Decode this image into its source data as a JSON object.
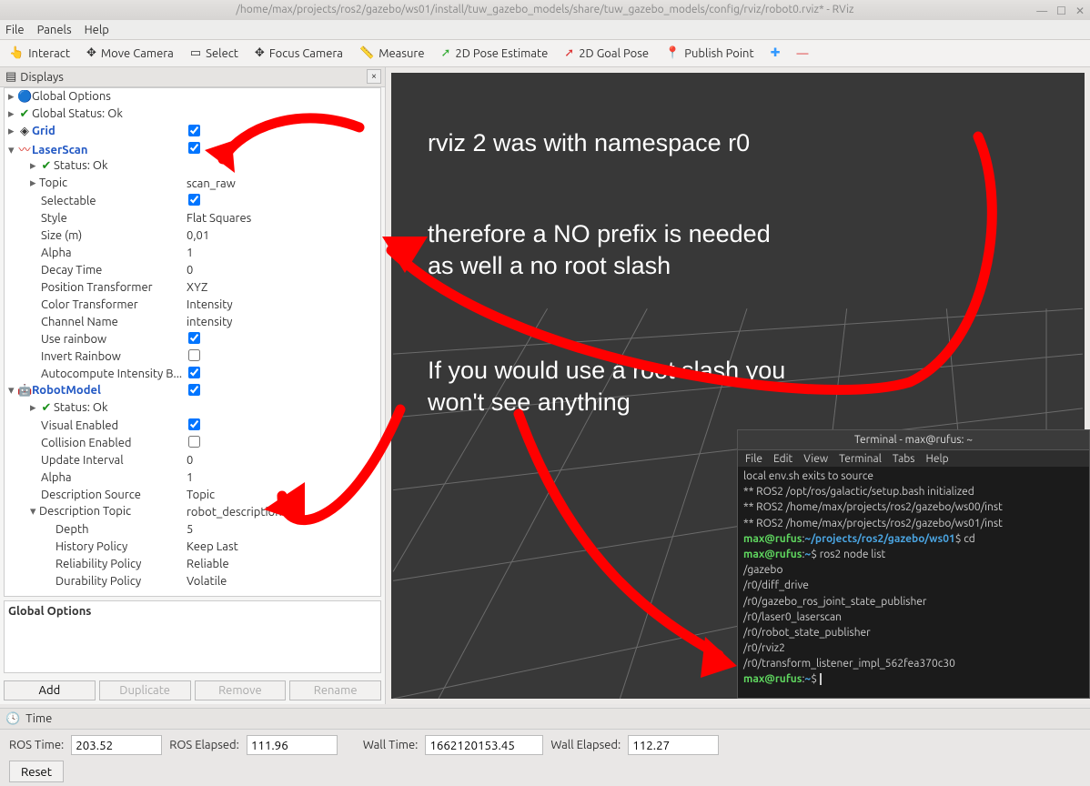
{
  "window": {
    "title": "/home/max/projects/ros2/gazebo/ws01/install/tuw_gazebo_models/share/tuw_gazebo_models/config/rviz/robot0.rviz* - RViz"
  },
  "menubar": [
    "File",
    "Panels",
    "Help"
  ],
  "toolbar": {
    "interact": "Interact",
    "move": "Move Camera",
    "select": "Select",
    "focus": "Focus Camera",
    "measure": "Measure",
    "est": "2D Pose Estimate",
    "goal": "2D Goal Pose",
    "pub": "Publish Point"
  },
  "displays_title": "Displays",
  "tree": {
    "global_options": "Global Options",
    "global_status": "Global Status: Ok",
    "grid": "Grid",
    "laserscan": "LaserScan",
    "ls_status": "Status: Ok",
    "ls_topic_k": "Topic",
    "ls_topic_v": "scan_raw",
    "ls_selectable": "Selectable",
    "ls_style_k": "Style",
    "ls_style_v": "Flat Squares",
    "ls_size_k": "Size (m)",
    "ls_size_v": "0,01",
    "ls_alpha_k": "Alpha",
    "ls_alpha_v": "1",
    "ls_decay_k": "Decay Time",
    "ls_decay_v": "0",
    "ls_pos_k": "Position Transformer",
    "ls_pos_v": "XYZ",
    "ls_col_k": "Color Transformer",
    "ls_col_v": "Intensity",
    "ls_chan_k": "Channel Name",
    "ls_chan_v": "intensity",
    "ls_rain_k": "Use rainbow",
    "ls_inv_k": "Invert Rainbow",
    "ls_auto_k": "Autocompute Intensity B...",
    "robotmodel": "RobotModel",
    "rm_status": "Status: Ok",
    "rm_vis_k": "Visual Enabled",
    "rm_col_k": "Collision Enabled",
    "rm_upd_k": "Update Interval",
    "rm_upd_v": "0",
    "rm_alpha_k": "Alpha",
    "rm_alpha_v": "1",
    "rm_src_k": "Description Source",
    "rm_src_v": "Topic",
    "rm_topic_k": "Description Topic",
    "rm_topic_v": "robot_description",
    "rm_depth_k": "Depth",
    "rm_depth_v": "5",
    "rm_hist_k": "History Policy",
    "rm_hist_v": "Keep Last",
    "rm_rel_k": "Reliability Policy",
    "rm_rel_v": "Reliable",
    "rm_dur_k": "Durability Policy",
    "rm_dur_v": "Volatile"
  },
  "detail_title": "Global Options",
  "buttons": {
    "add": "Add",
    "dup": "Duplicate",
    "rem": "Remove",
    "ren": "Rename"
  },
  "time_title": "Time",
  "time": {
    "ros_time_l": "ROS Time:",
    "ros_time_v": "203.52",
    "ros_el_l": "ROS Elapsed:",
    "ros_el_v": "111.96",
    "wall_time_l": "Wall Time:",
    "wall_time_v": "1662120153.45",
    "wall_el_l": "Wall Elapsed:",
    "wall_el_v": "112.27"
  },
  "reset": "Reset",
  "annotations": {
    "a1": "rviz 2 was with namespace r0",
    "a2": "therefore a NO prefix is needed\nas well a no root slash",
    "a3": "If you would use a root slash you\nwon't see anything"
  },
  "terminal": {
    "title": "Terminal - max@rufus: ~",
    "menu": [
      "File",
      "Edit",
      "View",
      "Terminal",
      "Tabs",
      "Help"
    ],
    "lines": {
      "l1": "local env.sh exits to source",
      "l2": "** ROS2 /opt/ros/galactic/setup.bash initialized",
      "l3": "** ROS2 /home/max/projects/ros2/gazebo/ws00/inst",
      "l4": "** ROS2 /home/max/projects/ros2/gazebo/ws01/inst",
      "p1u": "max@rufus",
      "p1p": "~/projects/ros2/gazebo/ws01",
      "p1c": "$ cd",
      "p2u": "max@rufus",
      "p2p": "~",
      "p2c": "$ ros2 node list",
      "n1": "/gazebo",
      "n2": "/r0/diff_drive",
      "n3": "/r0/gazebo_ros_joint_state_publisher",
      "n4": "/r0/laser0_laserscan",
      "n5": "/r0/robot_state_publisher",
      "n6": "/r0/rviz2",
      "n7": "/r0/transform_listener_impl_562fea370c30",
      "p3u": "max@rufus",
      "p3p": "~",
      "p3c": "$ "
    }
  }
}
